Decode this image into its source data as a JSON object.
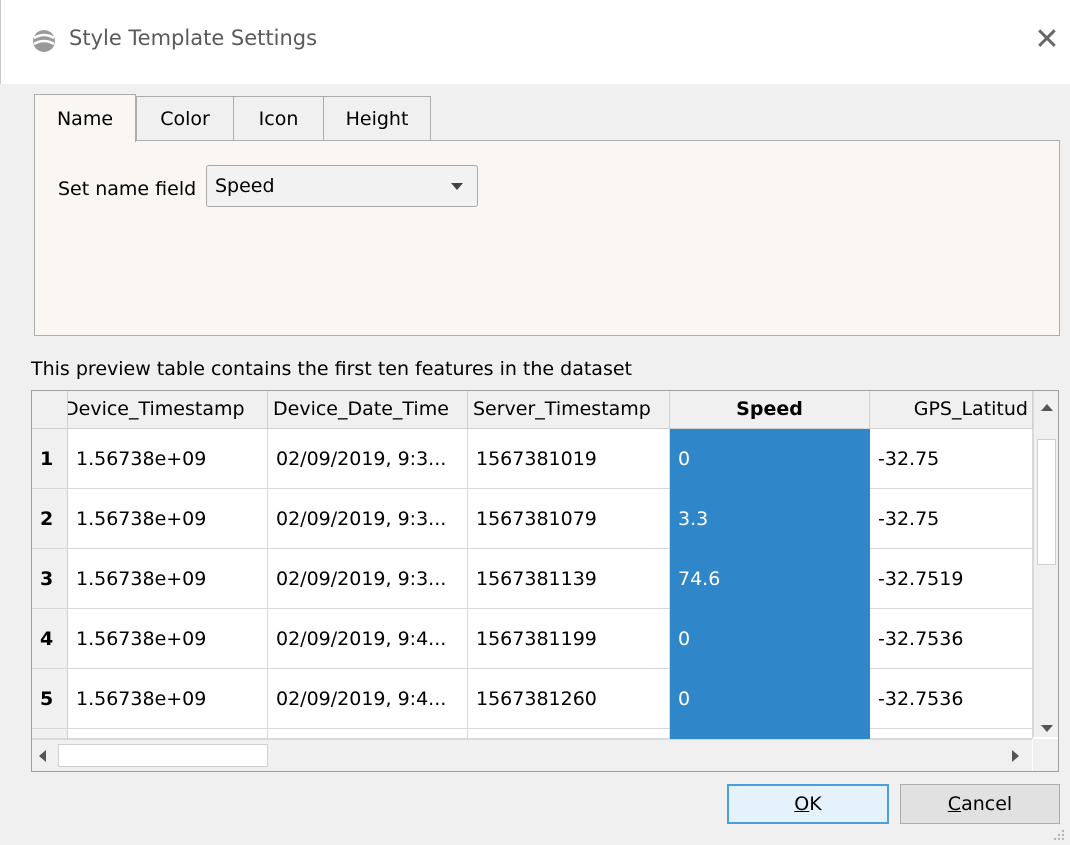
{
  "window": {
    "title": "Style Template Settings",
    "icon": "app-globe-icon",
    "close_glyph": "✕"
  },
  "tabs": [
    {
      "label": "Name",
      "active": true
    },
    {
      "label": "Color",
      "active": false
    },
    {
      "label": "Icon",
      "active": false
    },
    {
      "label": "Height",
      "active": false
    }
  ],
  "name_tab": {
    "field_label": "Set name field",
    "selected_field": "Speed"
  },
  "preview": {
    "description": "This preview table contains the first ten features in the dataset",
    "columns": [
      "Device_Timestamp",
      "Device_Date_Time",
      "Server_Timestamp",
      "Speed",
      "GPS_Latitud"
    ],
    "selected_column": "Speed",
    "rows": [
      {
        "num": "1",
        "cells": [
          "1.56738e+09",
          "02/09/2019, 9:3...",
          "1567381019",
          "0",
          "-32.75"
        ]
      },
      {
        "num": "2",
        "cells": [
          "1.56738e+09",
          "02/09/2019, 9:3...",
          "1567381079",
          "3.3",
          "-32.75"
        ]
      },
      {
        "num": "3",
        "cells": [
          "1.56738e+09",
          "02/09/2019, 9:3...",
          "1567381139",
          "74.6",
          "-32.7519"
        ]
      },
      {
        "num": "4",
        "cells": [
          "1.56738e+09",
          "02/09/2019, 9:4...",
          "1567381199",
          "0",
          "-32.7536"
        ]
      },
      {
        "num": "5",
        "cells": [
          "1.56738e+09",
          "02/09/2019, 9:4...",
          "1567381260",
          "0",
          "-32.7536"
        ]
      }
    ]
  },
  "buttons": {
    "ok_mnemonic": "O",
    "ok_rest": "K",
    "cancel_mnemonic": "C",
    "cancel_rest": "ancel"
  },
  "colors": {
    "selection": "#2f87c9",
    "panel": "#faf6f2",
    "default_button_border": "#4a9fe0"
  }
}
